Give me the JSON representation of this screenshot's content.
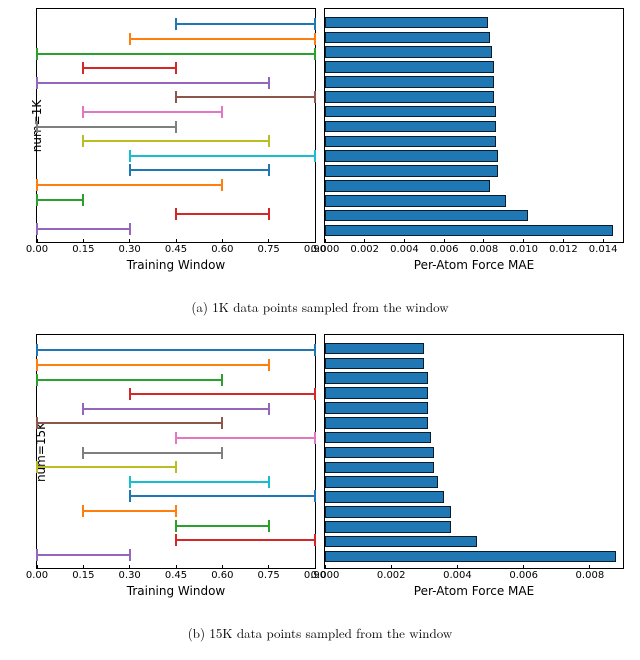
{
  "captions": {
    "a": "(a) 1K data points sampled from the window",
    "b": "(b) 15K data points sampled from the window"
  },
  "axis_labels": {
    "left_x": "Training Window",
    "right_x": "Per-Atom Force MAE",
    "ylabel_a": "num=1K",
    "ylabel_b": "num=15K"
  },
  "left_ticks": [
    "0.00",
    "0.15",
    "0.30",
    "0.45",
    "0.60",
    "0.75",
    "0.90"
  ],
  "right_ticks_a": [
    "0.000",
    "0.002",
    "0.004",
    "0.006",
    "0.008",
    "0.010",
    "0.012",
    "0.014"
  ],
  "right_ticks_b": [
    "0.000",
    "0.002",
    "0.004",
    "0.006",
    "0.008"
  ],
  "chart_data": [
    {
      "name": "panel_a",
      "left": {
        "type": "range",
        "xlabel": "Training Window",
        "ylabel": "num=1K",
        "xlim": [
          0.0,
          0.9
        ],
        "rows": [
          {
            "start": 0.45,
            "end": 0.9,
            "color": "#1f77b4"
          },
          {
            "start": 0.3,
            "end": 0.9,
            "color": "#ff7f0e"
          },
          {
            "start": 0.0,
            "end": 0.9,
            "color": "#2ca02c"
          },
          {
            "start": 0.15,
            "end": 0.45,
            "color": "#d62728"
          },
          {
            "start": 0.0,
            "end": 0.75,
            "color": "#9467bd"
          },
          {
            "start": 0.45,
            "end": 0.9,
            "color": "#8c564b"
          },
          {
            "start": 0.15,
            "end": 0.6,
            "color": "#e377c2"
          },
          {
            "start": 0.0,
            "end": 0.45,
            "color": "#7f7f7f"
          },
          {
            "start": 0.15,
            "end": 0.75,
            "color": "#bcbd22"
          },
          {
            "start": 0.3,
            "end": 0.9,
            "color": "#17becf"
          },
          {
            "start": 0.3,
            "end": 0.75,
            "color": "#1f77b4"
          },
          {
            "start": 0.0,
            "end": 0.6,
            "color": "#ff7f0e"
          },
          {
            "start": 0.0,
            "end": 0.15,
            "color": "#2ca02c"
          },
          {
            "start": 0.45,
            "end": 0.75,
            "color": "#d62728"
          },
          {
            "start": 0.0,
            "end": 0.3,
            "color": "#9467bd"
          }
        ]
      },
      "right": {
        "type": "bar",
        "orientation": "horizontal",
        "xlabel": "Per-Atom Force MAE",
        "xlim": [
          0.0,
          0.015
        ],
        "values": [
          0.0082,
          0.0083,
          0.0084,
          0.0085,
          0.0085,
          0.0085,
          0.0086,
          0.0086,
          0.0086,
          0.0087,
          0.0087,
          0.0083,
          0.0091,
          0.0102,
          0.0145
        ]
      }
    },
    {
      "name": "panel_b",
      "left": {
        "type": "range",
        "xlabel": "Training Window",
        "ylabel": "num=15K",
        "xlim": [
          0.0,
          0.9
        ],
        "rows": [
          {
            "start": 0.0,
            "end": 0.9,
            "color": "#1f77b4"
          },
          {
            "start": 0.0,
            "end": 0.75,
            "color": "#ff7f0e"
          },
          {
            "start": 0.0,
            "end": 0.6,
            "color": "#2ca02c"
          },
          {
            "start": 0.3,
            "end": 0.9,
            "color": "#d62728"
          },
          {
            "start": 0.15,
            "end": 0.75,
            "color": "#9467bd"
          },
          {
            "start": 0.0,
            "end": 0.6,
            "color": "#8c564b"
          },
          {
            "start": 0.45,
            "end": 0.9,
            "color": "#e377c2"
          },
          {
            "start": 0.15,
            "end": 0.6,
            "color": "#7f7f7f"
          },
          {
            "start": 0.0,
            "end": 0.45,
            "color": "#bcbd22"
          },
          {
            "start": 0.3,
            "end": 0.75,
            "color": "#17becf"
          },
          {
            "start": 0.3,
            "end": 0.9,
            "color": "#1f77b4"
          },
          {
            "start": 0.15,
            "end": 0.45,
            "color": "#ff7f0e"
          },
          {
            "start": 0.45,
            "end": 0.75,
            "color": "#2ca02c"
          },
          {
            "start": 0.45,
            "end": 0.9,
            "color": "#d62728"
          },
          {
            "start": 0.0,
            "end": 0.3,
            "color": "#9467bd"
          }
        ]
      },
      "right": {
        "type": "bar",
        "orientation": "horizontal",
        "xlabel": "Per-Atom Force MAE",
        "xlim": [
          0.0,
          0.009
        ],
        "values": [
          0.003,
          0.003,
          0.0031,
          0.0031,
          0.0031,
          0.0031,
          0.0032,
          0.0033,
          0.0033,
          0.0034,
          0.0036,
          0.0038,
          0.0038,
          0.0046,
          0.0088
        ]
      }
    }
  ]
}
